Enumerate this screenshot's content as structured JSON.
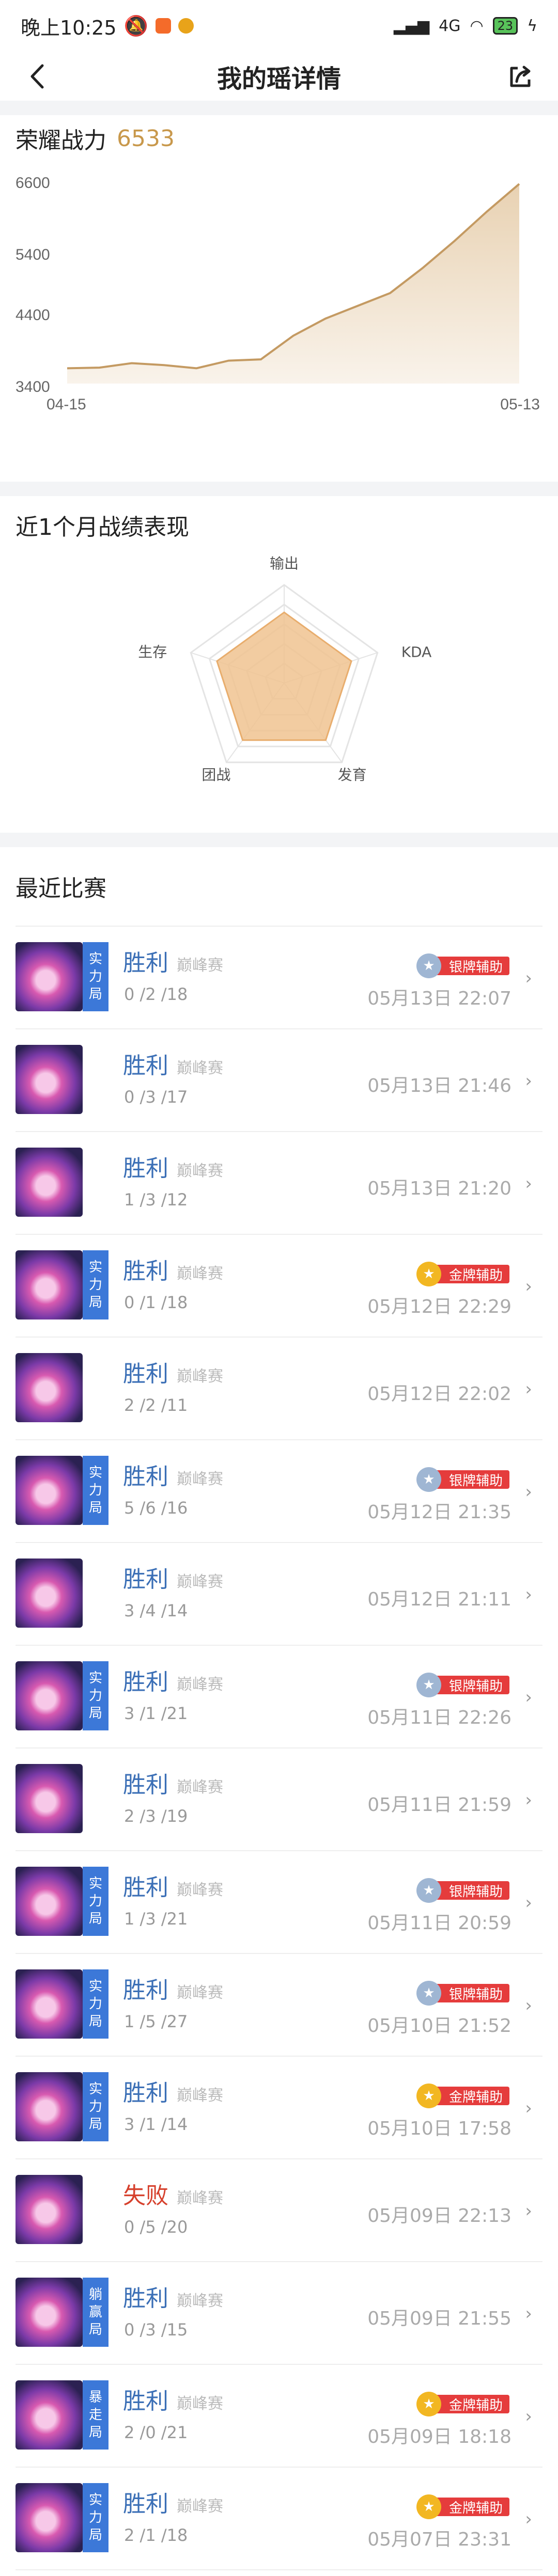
{
  "status": {
    "time": "晚上10:25",
    "signal": "4G",
    "battery": "23"
  },
  "nav": {
    "title": "我的瑶详情"
  },
  "glory": {
    "label": "荣耀战力",
    "value": "6533"
  },
  "chart_data": {
    "type": "area",
    "title": "",
    "x": [
      "04-15",
      "04-17",
      "04-19",
      "04-21",
      "04-23",
      "04-25",
      "04-27",
      "04-29",
      "05-01",
      "05-03",
      "05-05",
      "05-07",
      "05-09",
      "05-11",
      "05-13"
    ],
    "x_tick_labels": [
      "04-15",
      "05-13"
    ],
    "values": [
      3640,
      3650,
      3720,
      3690,
      3640,
      3760,
      3780,
      4150,
      4420,
      4620,
      4820,
      5210,
      5640,
      6100,
      6533
    ],
    "y_tick_labels": [
      "6600",
      "5400",
      "4400",
      "3400"
    ],
    "ylim": [
      3400,
      6600
    ],
    "line_color": "#c49a62",
    "fill_color": "#e7cfae"
  },
  "radar": {
    "title": "近1个月战绩表现",
    "axes": [
      "输出",
      "KDA",
      "发育",
      "团战",
      "生存"
    ],
    "values": [
      0.72,
      0.72,
      0.72,
      0.72,
      0.72
    ],
    "fill_color": "#f0c391"
  },
  "recent": {
    "title": "最近比赛",
    "matches": [
      {
        "result": "胜利",
        "lose": false,
        "mode": "巅峰赛",
        "kda": "0 /2 /18",
        "time": "05月13日 22:07",
        "tag": [
          "实",
          "力",
          "局"
        ],
        "medal": "银牌辅助",
        "medal_type": "silver"
      },
      {
        "result": "胜利",
        "lose": false,
        "mode": "巅峰赛",
        "kda": "0 /3 /17",
        "time": "05月13日 21:46",
        "tag": [],
        "medal": "",
        "medal_type": ""
      },
      {
        "result": "胜利",
        "lose": false,
        "mode": "巅峰赛",
        "kda": "1 /3 /12",
        "time": "05月13日 21:20",
        "tag": [],
        "medal": "",
        "medal_type": ""
      },
      {
        "result": "胜利",
        "lose": false,
        "mode": "巅峰赛",
        "kda": "0 /1 /18",
        "time": "05月12日 22:29",
        "tag": [
          "实",
          "力",
          "局"
        ],
        "medal": "金牌辅助",
        "medal_type": "gold"
      },
      {
        "result": "胜利",
        "lose": false,
        "mode": "巅峰赛",
        "kda": "2 /2 /11",
        "time": "05月12日 22:02",
        "tag": [],
        "medal": "",
        "medal_type": ""
      },
      {
        "result": "胜利",
        "lose": false,
        "mode": "巅峰赛",
        "kda": "5 /6 /16",
        "time": "05月12日 21:35",
        "tag": [
          "实",
          "力",
          "局"
        ],
        "medal": "银牌辅助",
        "medal_type": "silver"
      },
      {
        "result": "胜利",
        "lose": false,
        "mode": "巅峰赛",
        "kda": "3 /4 /14",
        "time": "05月12日 21:11",
        "tag": [],
        "medal": "",
        "medal_type": ""
      },
      {
        "result": "胜利",
        "lose": false,
        "mode": "巅峰赛",
        "kda": "3 /1 /21",
        "time": "05月11日 22:26",
        "tag": [
          "实",
          "力",
          "局"
        ],
        "medal": "银牌辅助",
        "medal_type": "silver"
      },
      {
        "result": "胜利",
        "lose": false,
        "mode": "巅峰赛",
        "kda": "2 /3 /19",
        "time": "05月11日 21:59",
        "tag": [],
        "medal": "",
        "medal_type": ""
      },
      {
        "result": "胜利",
        "lose": false,
        "mode": "巅峰赛",
        "kda": "1 /3 /21",
        "time": "05月11日 20:59",
        "tag": [
          "实",
          "力",
          "局"
        ],
        "medal": "银牌辅助",
        "medal_type": "silver"
      },
      {
        "result": "胜利",
        "lose": false,
        "mode": "巅峰赛",
        "kda": "1 /5 /27",
        "time": "05月10日 21:52",
        "tag": [
          "实",
          "力",
          "局"
        ],
        "medal": "银牌辅助",
        "medal_type": "silver"
      },
      {
        "result": "胜利",
        "lose": false,
        "mode": "巅峰赛",
        "kda": "3 /1 /14",
        "time": "05月10日 17:58",
        "tag": [
          "实",
          "力",
          "局"
        ],
        "medal": "金牌辅助",
        "medal_type": "gold"
      },
      {
        "result": "失败",
        "lose": true,
        "mode": "巅峰赛",
        "kda": "0 /5 /20",
        "time": "05月09日 22:13",
        "tag": [],
        "medal": "",
        "medal_type": ""
      },
      {
        "result": "胜利",
        "lose": false,
        "mode": "巅峰赛",
        "kda": "0 /3 /15",
        "time": "05月09日 21:55",
        "tag": [
          "躺",
          "赢",
          "局"
        ],
        "medal": "",
        "medal_type": ""
      },
      {
        "result": "胜利",
        "lose": false,
        "mode": "巅峰赛",
        "kda": "2 /0 /21",
        "time": "05月09日 18:18",
        "tag": [
          "暴",
          "走",
          "局"
        ],
        "medal": "金牌辅助",
        "medal_type": "gold"
      },
      {
        "result": "胜利",
        "lose": false,
        "mode": "巅峰赛",
        "kda": "2 /1 /18",
        "time": "05月07日 23:31",
        "tag": [
          "实",
          "力",
          "局"
        ],
        "medal": "金牌辅助",
        "medal_type": "gold"
      }
    ]
  }
}
